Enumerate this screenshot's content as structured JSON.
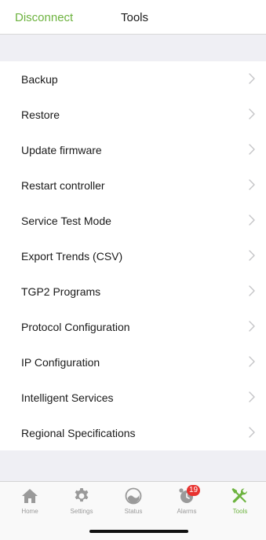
{
  "colors": {
    "accent": "#6db33f",
    "inactive_tab": "#9a9a9a",
    "badge": "#e8322f",
    "chevron": "#c4c4c7"
  },
  "header": {
    "back_label": "Disconnect",
    "title": "Tools"
  },
  "menu": {
    "items": [
      {
        "label": "Backup"
      },
      {
        "label": "Restore"
      },
      {
        "label": "Update firmware"
      },
      {
        "label": "Restart controller"
      },
      {
        "label": "Service Test Mode"
      },
      {
        "label": "Export Trends (CSV)"
      },
      {
        "label": "TGP2 Programs"
      },
      {
        "label": "Protocol Configuration"
      },
      {
        "label": "IP Configuration"
      },
      {
        "label": "Intelligent Services"
      },
      {
        "label": "Regional Specifications"
      }
    ]
  },
  "tabbar": {
    "tabs": [
      {
        "label": "Home",
        "icon": "home-icon",
        "active": false
      },
      {
        "label": "Settings",
        "icon": "gear-icon",
        "active": false
      },
      {
        "label": "Status",
        "icon": "gauge-icon",
        "active": false
      },
      {
        "label": "Alarms",
        "icon": "alarm-clock-icon",
        "active": false,
        "badge": "19"
      },
      {
        "label": "Tools",
        "icon": "tools-icon",
        "active": true
      }
    ]
  }
}
